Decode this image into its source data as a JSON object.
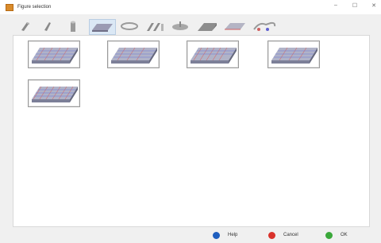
{
  "window": {
    "title": "Figure selection",
    "minimize_glyph": "–",
    "maximize_glyph": "☐",
    "close_glyph": "✕"
  },
  "toolbar": {
    "tools": [
      {
        "name": "tool-ramp-left-icon"
      },
      {
        "name": "tool-ramp-right-icon"
      },
      {
        "name": "tool-column-icon"
      },
      {
        "name": "tool-slab-icon"
      },
      {
        "name": "tool-ring-icon"
      },
      {
        "name": "tool-wall-pair-icon"
      },
      {
        "name": "tool-disc-icon"
      },
      {
        "name": "tool-block-icon"
      },
      {
        "name": "tool-plate-icon"
      },
      {
        "name": "tool-curved-shape-icon"
      }
    ]
  },
  "figures": [
    {
      "name": "figure-thumb-1"
    },
    {
      "name": "figure-thumb-2"
    },
    {
      "name": "figure-thumb-3"
    },
    {
      "name": "figure-thumb-4"
    },
    {
      "name": "figure-thumb-5"
    }
  ],
  "footer": {
    "help_label": "Help",
    "cancel_label": "Cancel",
    "ok_label": "OK",
    "colors": {
      "help": "#1f5fbf",
      "cancel": "#d9322b",
      "ok": "#3aa83a"
    }
  }
}
